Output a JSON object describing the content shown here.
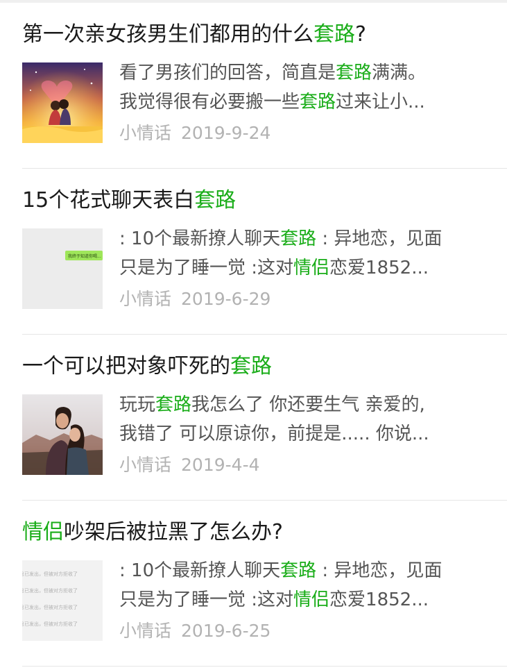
{
  "colors": {
    "highlight": "#1aad19",
    "title": "#1a1a1a",
    "summary": "#555555",
    "meta": "#b2b2b2"
  },
  "results": [
    {
      "title": [
        {
          "text": "第一次亲女孩男生们都用的什么"
        },
        {
          "text": "套路",
          "hl": true
        },
        {
          "text": "?"
        }
      ],
      "summary_lines": [
        [
          {
            "text": "看了男孩们的回答，简直是"
          },
          {
            "text": "套路",
            "hl": true
          },
          {
            "text": "满满。"
          }
        ],
        [
          {
            "text": "我觉得很有必要搬一些"
          },
          {
            "text": "套路",
            "hl": true
          },
          {
            "text": "过来让小..."
          }
        ]
      ],
      "source": "小情话",
      "date": "2019-9-24",
      "thumb": "couple-on-moon-image"
    },
    {
      "title": [
        {
          "text": "15个花式聊天表白"
        },
        {
          "text": "套路",
          "hl": true
        }
      ],
      "summary_lines": [
        [
          {
            "text": ": 10个最新撩人聊天"
          },
          {
            "text": "套路",
            "hl": true
          },
          {
            "text": " : 异地恋，见面"
          }
        ],
        [
          {
            "text": "只是为了睡一觉 :这对"
          },
          {
            "text": "情侣",
            "hl": true
          },
          {
            "text": "恋爱1852..."
          }
        ]
      ],
      "source": "小情话",
      "date": "2019-6-29",
      "thumb": "chat-screenshot-image",
      "thumb_text": "我终于知道你喝..."
    },
    {
      "title": [
        {
          "text": "一个可以把对象吓死的"
        },
        {
          "text": "套路",
          "hl": true
        }
      ],
      "summary_lines": [
        [
          {
            "text": "玩玩"
          },
          {
            "text": "套路",
            "hl": true
          },
          {
            "text": "我怎么了 你还要生气 亲爱的,"
          }
        ],
        [
          {
            "text": "我错了 可以原谅你，前提是..... 你说..."
          }
        ]
      ],
      "source": "小情话",
      "date": "2019-4-4",
      "thumb": "couple-kissing-photo"
    },
    {
      "title": [
        {
          "text": "情侣",
          "hl": true
        },
        {
          "text": "吵架后被拉黑了怎么办?"
        }
      ],
      "summary_lines": [
        [
          {
            "text": ": 10个最新撩人聊天"
          },
          {
            "text": "套路",
            "hl": true
          },
          {
            "text": " : 异地恋，见面"
          }
        ],
        [
          {
            "text": "只是为了睡一觉 :这对"
          },
          {
            "text": "情侣",
            "hl": true
          },
          {
            "text": "恋爱1852..."
          }
        ]
      ],
      "source": "小情话",
      "date": "2019-6-25",
      "thumb": "blocked-message-screenshot",
      "thumb_text": "息已发出，但被对方拒收了"
    }
  ]
}
